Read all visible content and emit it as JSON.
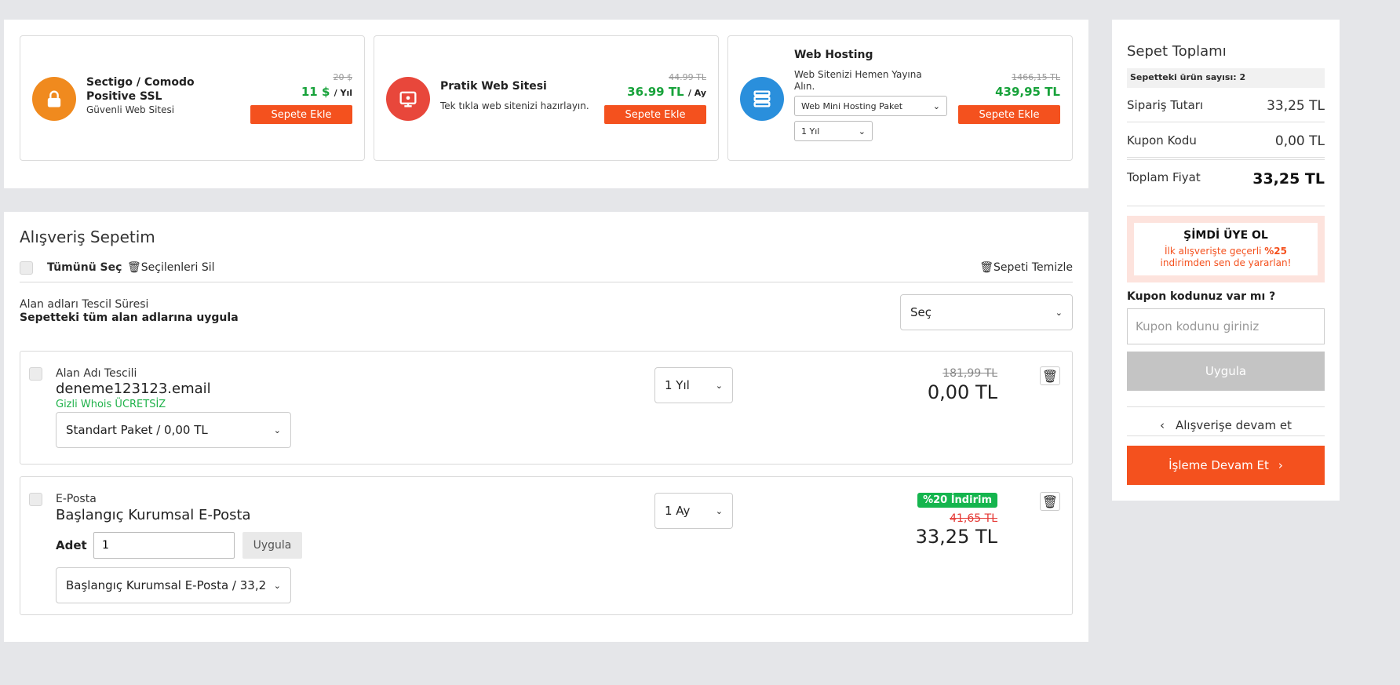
{
  "promos": [
    {
      "title": "Sectigo / Comodo Positive SSL",
      "desc": "Güvenli Web Sitesi",
      "old_price": "20 $",
      "price": "11 $",
      "unit": "/ Yıl",
      "button": "Sepete Ekle",
      "icon": "lock-icon",
      "color": "#f08a1e"
    },
    {
      "title": "Pratik Web Sitesi",
      "desc": "Tek tıkla web sitenizi hazırlayın.",
      "old_price": "44.99 TL",
      "price": "36.99 TL",
      "unit": "/ Ay",
      "button": "Sepete Ekle",
      "icon": "monitor-icon",
      "color": "#e8473b"
    },
    {
      "title": "Web Hosting",
      "desc": "Web Sitenizi Hemen Yayına Alın.",
      "old_price": "1466,15 TL",
      "price": "439,95 TL",
      "unit": "",
      "button": "Sepete Ekle",
      "icon": "server-icon",
      "color": "#2a8fdc",
      "package_select": "Web Mini Hosting Paket",
      "period_select": "1 Yıl"
    }
  ],
  "cart": {
    "title": "Alışveriş Sepetim",
    "select_all": "Tümünü Seç",
    "delete_selected": "Seçilenleri Sil",
    "clear_cart": "Sepeti Temizle",
    "reg_label": "Alan adları Tescil Süresi",
    "reg_sub": "Sepetteki tüm alan adlarına uygula",
    "reg_select": "Seç",
    "items": [
      {
        "type": "Alan Adı Tescili",
        "name": "deneme123123.email",
        "whois": "Gizli Whois ÜCRETSİZ",
        "period": "1 Yıl",
        "old_price": "181,99 TL",
        "price": "0,00 TL",
        "package": "Standart Paket / 0,00 TL"
      },
      {
        "type": "E-Posta",
        "name": "Başlangıç Kurumsal E-Posta",
        "badge": "%20 İndirim",
        "period": "1 Ay",
        "old_price": "41,65 TL",
        "price": "33,25 TL",
        "qty_label": "Adet",
        "qty": "1",
        "qty_apply": "Uygula",
        "package": "Başlangıç Kurumsal E-Posta / 33,2"
      }
    ]
  },
  "summary": {
    "title": "Sepet Toplamı",
    "count_label": "Sepetteki ürün sayısı:",
    "count": "2",
    "order_label": "Sipariş Tutarı",
    "order_value": "33,25 TL",
    "coupon_label": "Kupon Kodu",
    "coupon_value": "0,00 TL",
    "total_label": "Toplam Fiyat",
    "total_value": "33,25 TL",
    "member_title": "ŞİMDİ ÜYE OL",
    "member_text_1": "İlk alışverişte geçerli",
    "member_discount": "%25",
    "member_text_2": "indirimden sen de yararlan!",
    "coupon_question": "Kupon kodunuz var mı ?",
    "coupon_placeholder": "Kupon kodunu giriniz",
    "apply": "Uygula",
    "continue_shopping": "Alışverişe devam et",
    "proceed": "İşleme Devam Et"
  }
}
